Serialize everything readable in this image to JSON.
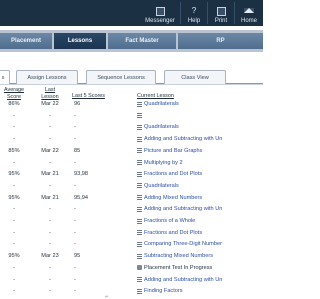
{
  "header": {
    "items": [
      {
        "label": "Messenger"
      },
      {
        "label": "Help"
      },
      {
        "label": "Print"
      },
      {
        "label": "Home"
      }
    ]
  },
  "nav": {
    "tabs": [
      {
        "label": "Placement"
      },
      {
        "label": "Lessons"
      },
      {
        "label": "Fact Master"
      },
      {
        "label": "RP"
      }
    ]
  },
  "subtabs": [
    {
      "label": "s"
    },
    {
      "label": "Assign Lessons"
    },
    {
      "label": "Sequence Lessons"
    },
    {
      "label": "Class View"
    }
  ],
  "table": {
    "columns": [
      {
        "label": "Average Score"
      },
      {
        "label": "Last Lesson"
      },
      {
        "label": "Last 5 Scores"
      },
      {
        "label": "Current Lesson"
      }
    ],
    "rows": [
      {
        "avg": "86%",
        "last": "Mar 22",
        "scores": "96",
        "lesson": "Quadrilaterals",
        "link": true
      },
      {
        "avg": "-",
        "last": "-",
        "scores": "-",
        "lesson": "",
        "link": true
      },
      {
        "avg": "-",
        "last": "-",
        "scores": "-",
        "lesson": "Quadrilaterals",
        "link": true
      },
      {
        "avg": "-",
        "last": "-",
        "scores": "-",
        "lesson": "Adding and Subtracting with Un",
        "link": true
      },
      {
        "avg": "85%",
        "last": "Mar 22",
        "scores": "85",
        "lesson": "Picture and Bar Graphs",
        "link": true
      },
      {
        "avg": "-",
        "last": "-",
        "scores": "-",
        "lesson": "Multiplying by 2",
        "link": true
      },
      {
        "avg": "95%",
        "last": "Mar 21",
        "scores": "93,98",
        "lesson": "Fractions and Dot Plots",
        "link": true
      },
      {
        "avg": "-",
        "last": "-",
        "scores": "-",
        "lesson": "Quadrilaterals",
        "link": true
      },
      {
        "avg": "95%",
        "last": "Mar 21",
        "scores": "95,94",
        "lesson": "Adding Mixed Numbers",
        "link": true
      },
      {
        "avg": "-",
        "last": "-",
        "scores": "-",
        "lesson": "Adding and Subtracting with Un",
        "link": true
      },
      {
        "avg": "-",
        "last": "-",
        "scores": "-",
        "lesson": "Fractions of a Whole",
        "link": true
      },
      {
        "avg": "-",
        "last": "-",
        "scores": "-",
        "lesson": "Fractions and Dot Plots",
        "link": true
      },
      {
        "avg": "-",
        "last": "-",
        "scores": "-",
        "lesson": "Comparing Three-Digit Number",
        "link": true
      },
      {
        "avg": "95%",
        "last": "Mar 23",
        "scores": "95",
        "lesson": "Subtracting Mixed Numbers",
        "link": true
      },
      {
        "avg": "-",
        "last": "-",
        "scores": "-",
        "lesson": "Placement Test In Progress",
        "link": false
      },
      {
        "avg": "-",
        "last": "-",
        "scores": "-",
        "lesson": "Adding and Subtracting with Un",
        "link": true
      },
      {
        "avg": "-",
        "last": "-",
        "scores": "-",
        "lesson": "Finding Factors",
        "link": true
      }
    ]
  },
  "colors": {
    "header_bg": "#1c3044",
    "nav_active": "#1c3452",
    "link": "#2d4ea5"
  }
}
